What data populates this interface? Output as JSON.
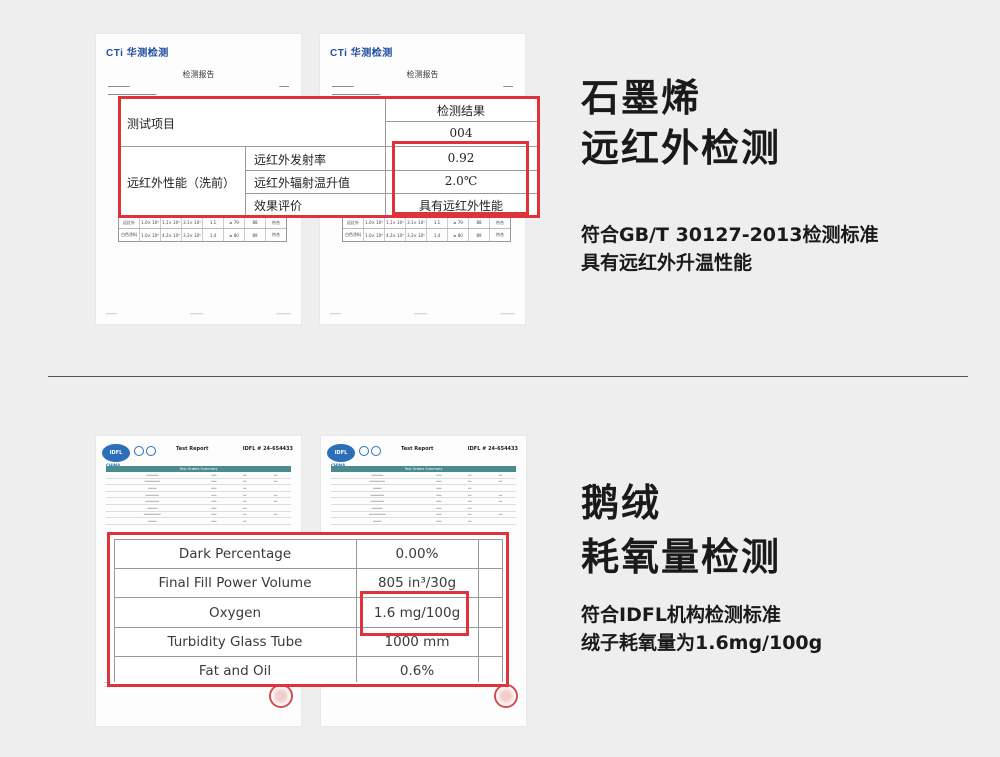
{
  "section1": {
    "report": {
      "logo": "CTi 华测检测",
      "title": "检测报告",
      "mini_rows": [
        [
          "远红外",
          "1.0× 10⁵",
          "1.1× 10⁵",
          "3.1× 10⁵",
          "1.1",
          "≥ 79",
          "88",
          "符合"
        ],
        [
          "白色涂料",
          "1.0× 10⁵",
          "4.3× 10⁵",
          "3.3× 10⁵",
          "1.4",
          "≥ 80",
          "89",
          "符合"
        ]
      ]
    },
    "zoom_table": {
      "header_item": "测试项目",
      "header_result": "检测结果",
      "sample_no": "004",
      "category": "远红外性能（洗前）",
      "rows": [
        {
          "item": "远红外发射率",
          "result": "0.92"
        },
        {
          "item": "远红外辐射温升值",
          "result": "2.0℃"
        },
        {
          "item": "效果评价",
          "result": "具有远红外性能"
        }
      ]
    },
    "heading": [
      "石墨烯",
      "远红外检测"
    ],
    "subtext": [
      "符合GB/T 30127-2013检测标准",
      "具有远红外升温性能"
    ]
  },
  "section2": {
    "report": {
      "logo": "IDFL",
      "china": "CHINA",
      "title": "Test Report",
      "report_no": "IDFL # 24-654433",
      "summary_header": "Test Orders Summary"
    },
    "zoom_table": {
      "rows": [
        {
          "label": "Dark Percentage",
          "value": "0.00%"
        },
        {
          "label": "Final Fill Power Volume",
          "value": "805 in³/30g"
        },
        {
          "label": "Oxygen",
          "value": "1.6 mg/100g"
        },
        {
          "label": "Turbidity Glass Tube",
          "value": "1000 mm"
        },
        {
          "label": "Fat and Oil",
          "value": "0.6%"
        }
      ]
    },
    "heading": [
      "鹅绒",
      "耗氧量检测"
    ],
    "subtext": [
      "符合IDFL机构检测标准",
      "绒子耗氧量为1.6mg/100g"
    ]
  },
  "colors": {
    "highlight": "#e0323b",
    "background": "#eeeeee",
    "brand_blue": "#1f4e9e"
  }
}
